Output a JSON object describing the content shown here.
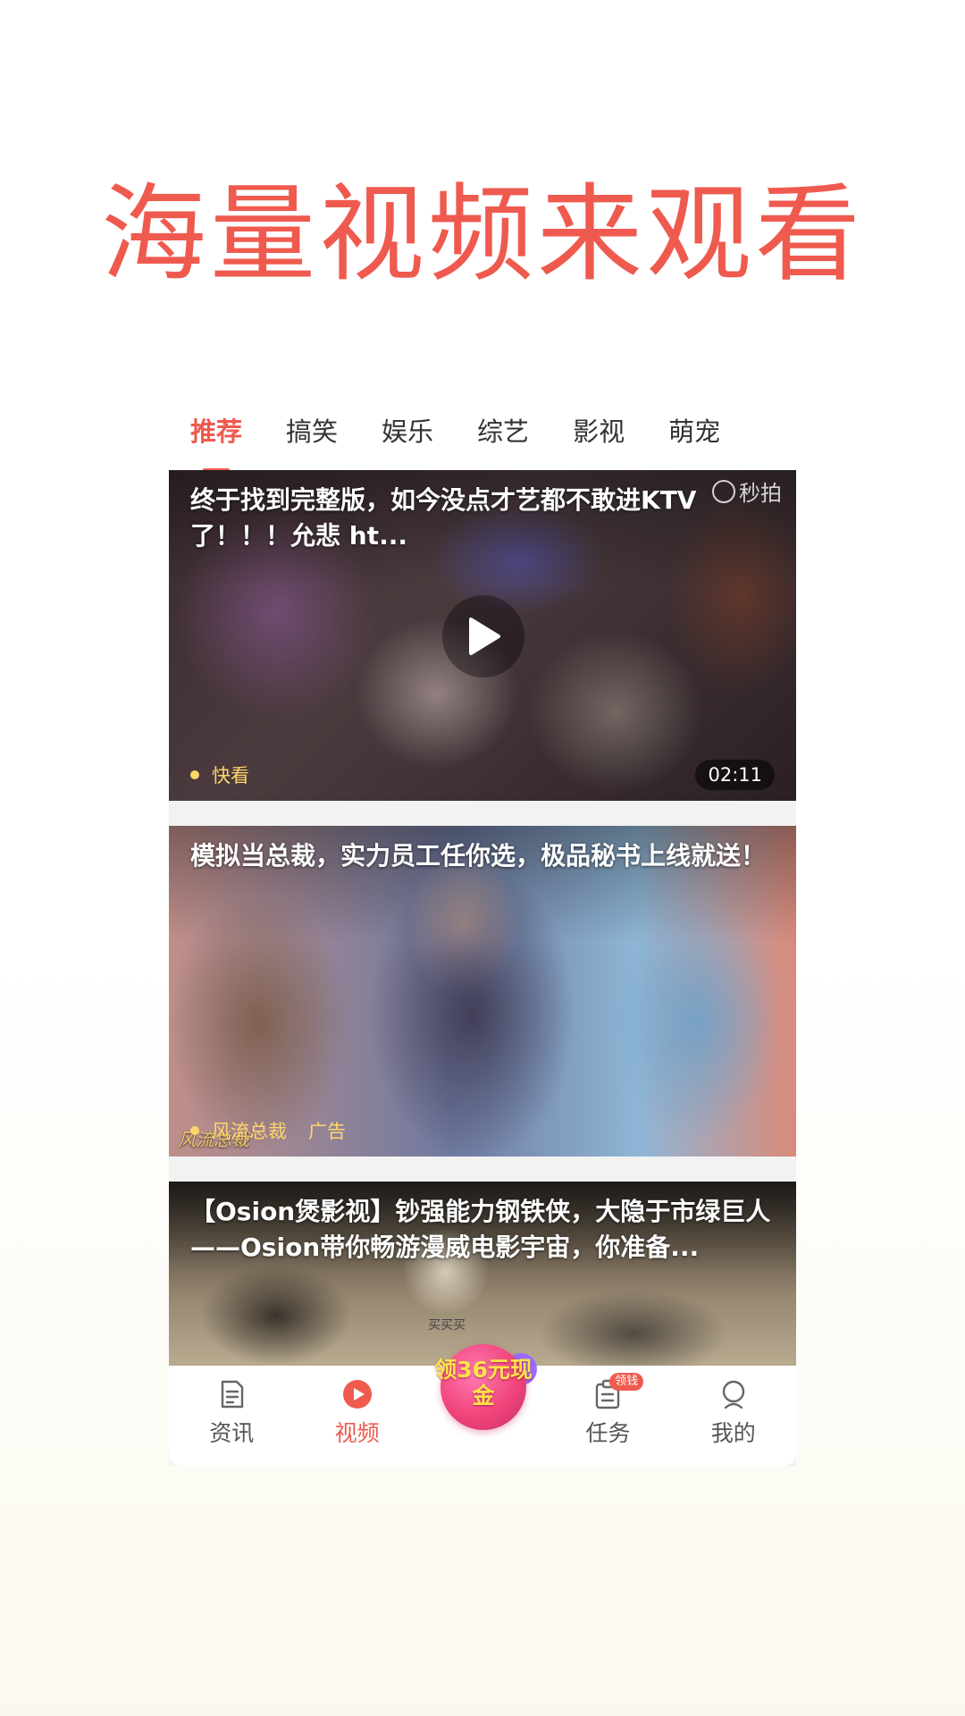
{
  "headline": "海量视频来观看",
  "tabs": [
    {
      "label": "推荐",
      "active": true
    },
    {
      "label": "搞笑"
    },
    {
      "label": "娱乐"
    },
    {
      "label": "综艺"
    },
    {
      "label": "影视"
    },
    {
      "label": "萌宠"
    }
  ],
  "feed": [
    {
      "title": "终于找到完整版，如今没点才艺都不敢进KTV了！！！允悲  ht...",
      "source": "快看",
      "duration": "02:11",
      "watermark": "秒拍"
    },
    {
      "title": "模拟当总裁，实力员工任你选，极品秘书上线就送！",
      "source": "风流总裁",
      "ad_label": "广告",
      "logo_text": "风流总裁"
    },
    {
      "title": "【Osion煲影视】钞强能力钢铁侠，大隐于市绿巨人——Osion带你畅游漫威电影宇宙，你准备...",
      "caption": "买买买"
    }
  ],
  "bottom_nav": {
    "items": [
      {
        "label": "资讯",
        "icon": "news-icon"
      },
      {
        "label": "视频",
        "icon": "video-play-icon",
        "active": true
      },
      {
        "label": "任务",
        "icon": "task-icon",
        "badge": "领钱"
      },
      {
        "label": "我的",
        "icon": "profile-icon"
      }
    ],
    "cash_button": "领36元现金"
  },
  "colors": {
    "accent": "#ef5a4f",
    "cash": "#f0457a",
    "source_tag": "#ffd66b"
  }
}
